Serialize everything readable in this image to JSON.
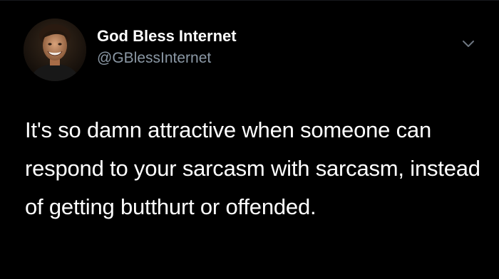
{
  "tweet": {
    "display_name": "God Bless Internet",
    "handle": "@GBlessInternet",
    "text": "It's so damn attractive when someone can respond to your sarcasm with sarcasm, instead of getting butthurt or offended.",
    "avatar_icon": "profile-photo",
    "menu_icon": "chevron-down-icon"
  },
  "colors": {
    "background": "#000000",
    "primary_text": "#ffffff",
    "secondary_text": "#8b98a5"
  }
}
